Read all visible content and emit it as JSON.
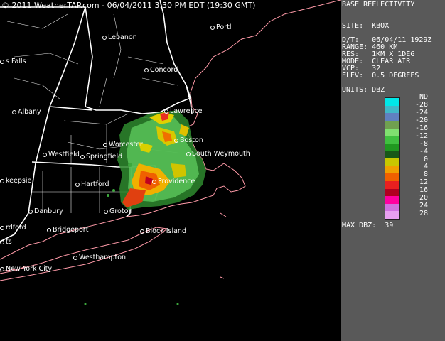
{
  "map": {
    "copyright": "© 2011 WeatherTAP.com - 06/04/2011  3:30 PM EDT (19:30 GMT)",
    "cities": [
      {
        "name": "Lebanon",
        "dot": true
      },
      {
        "name": "Portl",
        "dot": true
      },
      {
        "name": "s Falls",
        "dot": true
      },
      {
        "name": "Concord",
        "dot": true
      },
      {
        "name": "Albany",
        "dot": true
      },
      {
        "name": "Lawrence",
        "dot": true
      },
      {
        "name": "Boston",
        "dot": true
      },
      {
        "name": "Worcester",
        "dot": true
      },
      {
        "name": "South Weymouth",
        "dot": true
      },
      {
        "name": "Westfield",
        "dot": true
      },
      {
        "name": "Springfield",
        "dot": true
      },
      {
        "name": "keepsie",
        "dot": true
      },
      {
        "name": "Hartford",
        "dot": true
      },
      {
        "name": "Providence",
        "dot": true
      },
      {
        "name": "Danbury",
        "dot": true
      },
      {
        "name": "Groton",
        "dot": true
      },
      {
        "name": "rdford",
        "dot": true
      },
      {
        "name": "Bridgeport",
        "dot": true
      },
      {
        "name": "Block Island",
        "dot": true
      },
      {
        "name": "ts",
        "dot": true
      },
      {
        "name": "New York City",
        "dot": true
      },
      {
        "name": "Westhampton",
        "dot": true
      }
    ]
  },
  "panel": {
    "product": "BASE REFLECTIVITY",
    "site": "SITE:  KBOX",
    "datetime": "D/T:   06/04/11 1929Z",
    "range": "RANGE: 460 KM",
    "res": "RES:   1KM X 1DEG",
    "mode": "MODE:  CLEAR AIR",
    "vcp": "VCP:   32",
    "elev": "ELEV:  0.5 DEGREES",
    "units": "UNITS: DBZ",
    "max": "MAX DBZ:  39",
    "scale_labels": [
      "ND",
      "-28",
      "-24",
      "-20",
      "-16",
      "-12",
      "-8",
      "-4",
      "0",
      "4",
      "8",
      "12",
      "16",
      "20",
      "24",
      "28"
    ],
    "scale_colors": [
      "#00e8e8",
      "#40b8c8",
      "#6080c0",
      "#70a050",
      "#80e070",
      "#40c040",
      "#209820",
      "#185818",
      "#c8c800",
      "#f0a000",
      "#f06000",
      "#e82020",
      "#b00020",
      "#ff00a0",
      "#d070e0",
      "#e8a0f0"
    ]
  }
}
